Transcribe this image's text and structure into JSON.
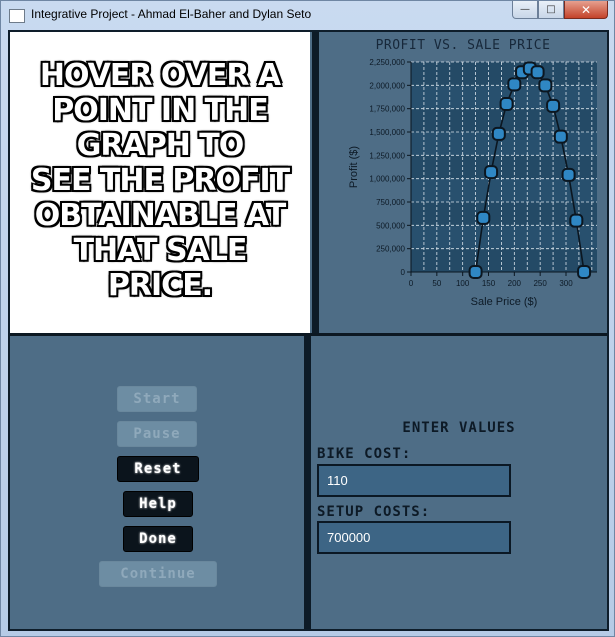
{
  "window": {
    "title": "Integrative Project - Ahmad El-Baher and Dylan Seto",
    "minimize_glyph": "—",
    "maximize_glyph": "□",
    "close_glyph": "✕"
  },
  "info": {
    "lines": [
      "HOVER OVER A",
      "POINT IN THE",
      "GRAPH TO",
      "SEE THE PROFIT",
      "OBTAINABLE AT",
      "THAT SALE",
      "PRICE."
    ]
  },
  "controls": {
    "start": "Start",
    "pause": "Pause",
    "reset": "Reset",
    "help": "Help",
    "done": "Done",
    "continue": "Continue"
  },
  "form": {
    "heading": "ENTER VALUES",
    "bike_cost_label": "BIKE COST:",
    "bike_cost_value": "110",
    "setup_costs_label": "SETUP COSTS:",
    "setup_costs_value": "700000"
  },
  "chart_data": {
    "type": "line",
    "title": "PROFIT VS. SALE PRICE",
    "xlabel": "Sale Price ($)",
    "ylabel": "Profit ($)",
    "xlim": [
      0,
      360
    ],
    "ylim": [
      0,
      2250000
    ],
    "xticks": [
      0,
      50,
      100,
      150,
      200,
      250,
      300
    ],
    "yticks": [
      0,
      250000,
      500000,
      750000,
      1000000,
      1250000,
      1500000,
      1750000,
      2000000,
      2250000
    ],
    "ytick_labels": [
      "0",
      "250,000",
      "500,000",
      "750,000",
      "1,000,000",
      "1,250,000",
      "1,500,000",
      "1,750,000",
      "2,000,000",
      "2,250,000"
    ],
    "grid": true,
    "x": [
      125,
      140,
      155,
      170,
      185,
      200,
      215,
      230,
      245,
      260,
      275,
      290,
      305,
      320,
      335
    ],
    "y": [
      0,
      580000,
      1070000,
      1480000,
      1800000,
      2010000,
      2140000,
      2180000,
      2140000,
      2000000,
      1780000,
      1450000,
      1040000,
      550000,
      0
    ],
    "colors": {
      "plot_bg": "#28506e",
      "band": "#244a66",
      "grid": "#d8e2ea",
      "line": "#0b1620",
      "marker": "#2f87c4",
      "marker_edge": "#0b1620"
    }
  }
}
